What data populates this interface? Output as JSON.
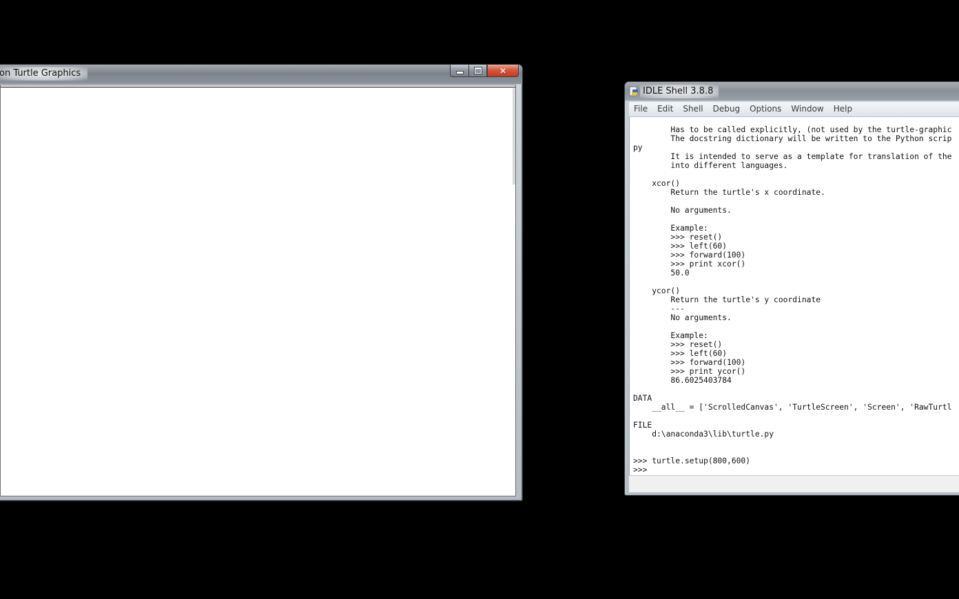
{
  "turtle_window": {
    "title": "on Turtle Graphics",
    "controls": {
      "minimize_icon": "minimize-icon",
      "maximize_icon": "maximize-icon",
      "close_label": "✕"
    }
  },
  "idle_window": {
    "title": "IDLE Shell 3.8.8",
    "menu": [
      "File",
      "Edit",
      "Shell",
      "Debug",
      "Options",
      "Window",
      "Help"
    ],
    "shell_lines": [
      "        Has to be called explicitly, (not used by the turtle-graphic",
      "        The docstring dictionary will be written to the Python scrip",
      "py",
      "        It is intended to serve as a template for translation of the",
      "        into different languages.",
      "",
      "    xcor()",
      "        Return the turtle's x coordinate.",
      "",
      "        No arguments.",
      "",
      "        Example:",
      "        >>> reset()",
      "        >>> left(60)",
      "        >>> forward(100)",
      "        >>> print xcor()",
      "        50.0",
      "",
      "    ycor()",
      "        Return the turtle's y coordinate",
      "        ---",
      "        No arguments.",
      "",
      "        Example:",
      "        >>> reset()",
      "        >>> left(60)",
      "        >>> forward(100)",
      "        >>> print ycor()",
      "        86.6025403784",
      "",
      "DATA",
      "    __all__ = ['ScrolledCanvas', 'TurtleScreen', 'Screen', 'RawTurtl",
      "",
      "FILE",
      "    d:\\anaconda3\\lib\\turtle.py",
      "",
      "",
      ">>> turtle.setup(800,600)",
      ">>> "
    ]
  },
  "colors": {
    "desktop": "#000000",
    "close_button": "#c23a22",
    "canvas": "#ffffff"
  }
}
